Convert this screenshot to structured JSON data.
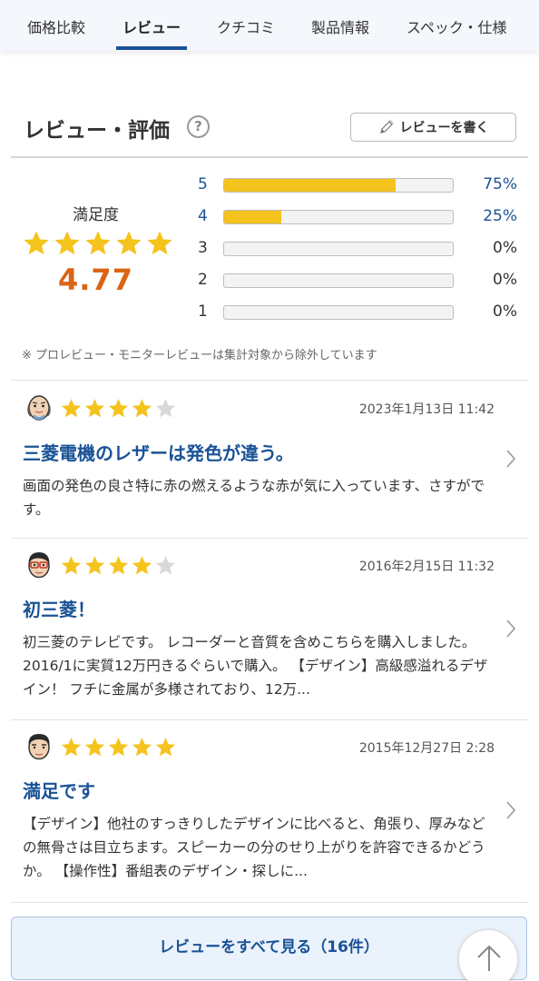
{
  "tabs": [
    {
      "label": "価格比較"
    },
    {
      "label": "レビュー"
    },
    {
      "label": "クチコミ"
    },
    {
      "label": "製品情報"
    },
    {
      "label": "スペック・仕様"
    }
  ],
  "active_tab": "レビュー",
  "section": {
    "title": "レビュー・評価",
    "help_icon": "question-icon",
    "write_button": "レビューを書く",
    "write_icon": "pencil-icon"
  },
  "summary": {
    "label": "満足度",
    "score": "4.77",
    "stars_filled": 5,
    "star_color": "#f5c31d",
    "score_color": "#d96515",
    "distribution": [
      {
        "stars": "5",
        "percent": "75%",
        "fraction": 0.75
      },
      {
        "stars": "4",
        "percent": "25%",
        "fraction": 0.25
      },
      {
        "stars": "3",
        "percent": "0%",
        "fraction": 0
      },
      {
        "stars": "2",
        "percent": "0%",
        "fraction": 0
      },
      {
        "stars": "1",
        "percent": "0%",
        "fraction": 0
      }
    ]
  },
  "note": "※ プロレビュー・モニターレビューは集計対象から除外しています",
  "reviews": [
    {
      "rating": 4,
      "date": "2023年1月13日 11:42",
      "title": "三菱電機のレザーは発色が違う。",
      "body": "画面の発色の良さ特に赤の燃えるような赤が気に入っています、さすがです。",
      "avatar": "bald-man-avatar"
    },
    {
      "rating": 4,
      "date": "2016年2月15日 11:32",
      "title": "初三菱！",
      "body": "初三菱のテレビです。 レコーダーと音質を含めこちらを購入しました。 2016/1に実質12万円きるぐらいで購入。 【デザイン】高級感溢れるデザイン！ フチに金属が多様されており、12万...",
      "avatar": "glasses-man-avatar"
    },
    {
      "rating": 5,
      "date": "2015年12月27日 2:28",
      "title": "満足です",
      "body": "【デザイン】他社のすっきりしたデザインに比べると、角張り、厚みなどの無骨さは目立ちます。スピーカーの分のせり上がりを許容できるかどうか。 【操作性】番組表のデザイン・探しに...",
      "avatar": "man-avatar"
    }
  ],
  "view_all": "レビューをすべて見る（16件）",
  "accent_color": "#1a5296"
}
